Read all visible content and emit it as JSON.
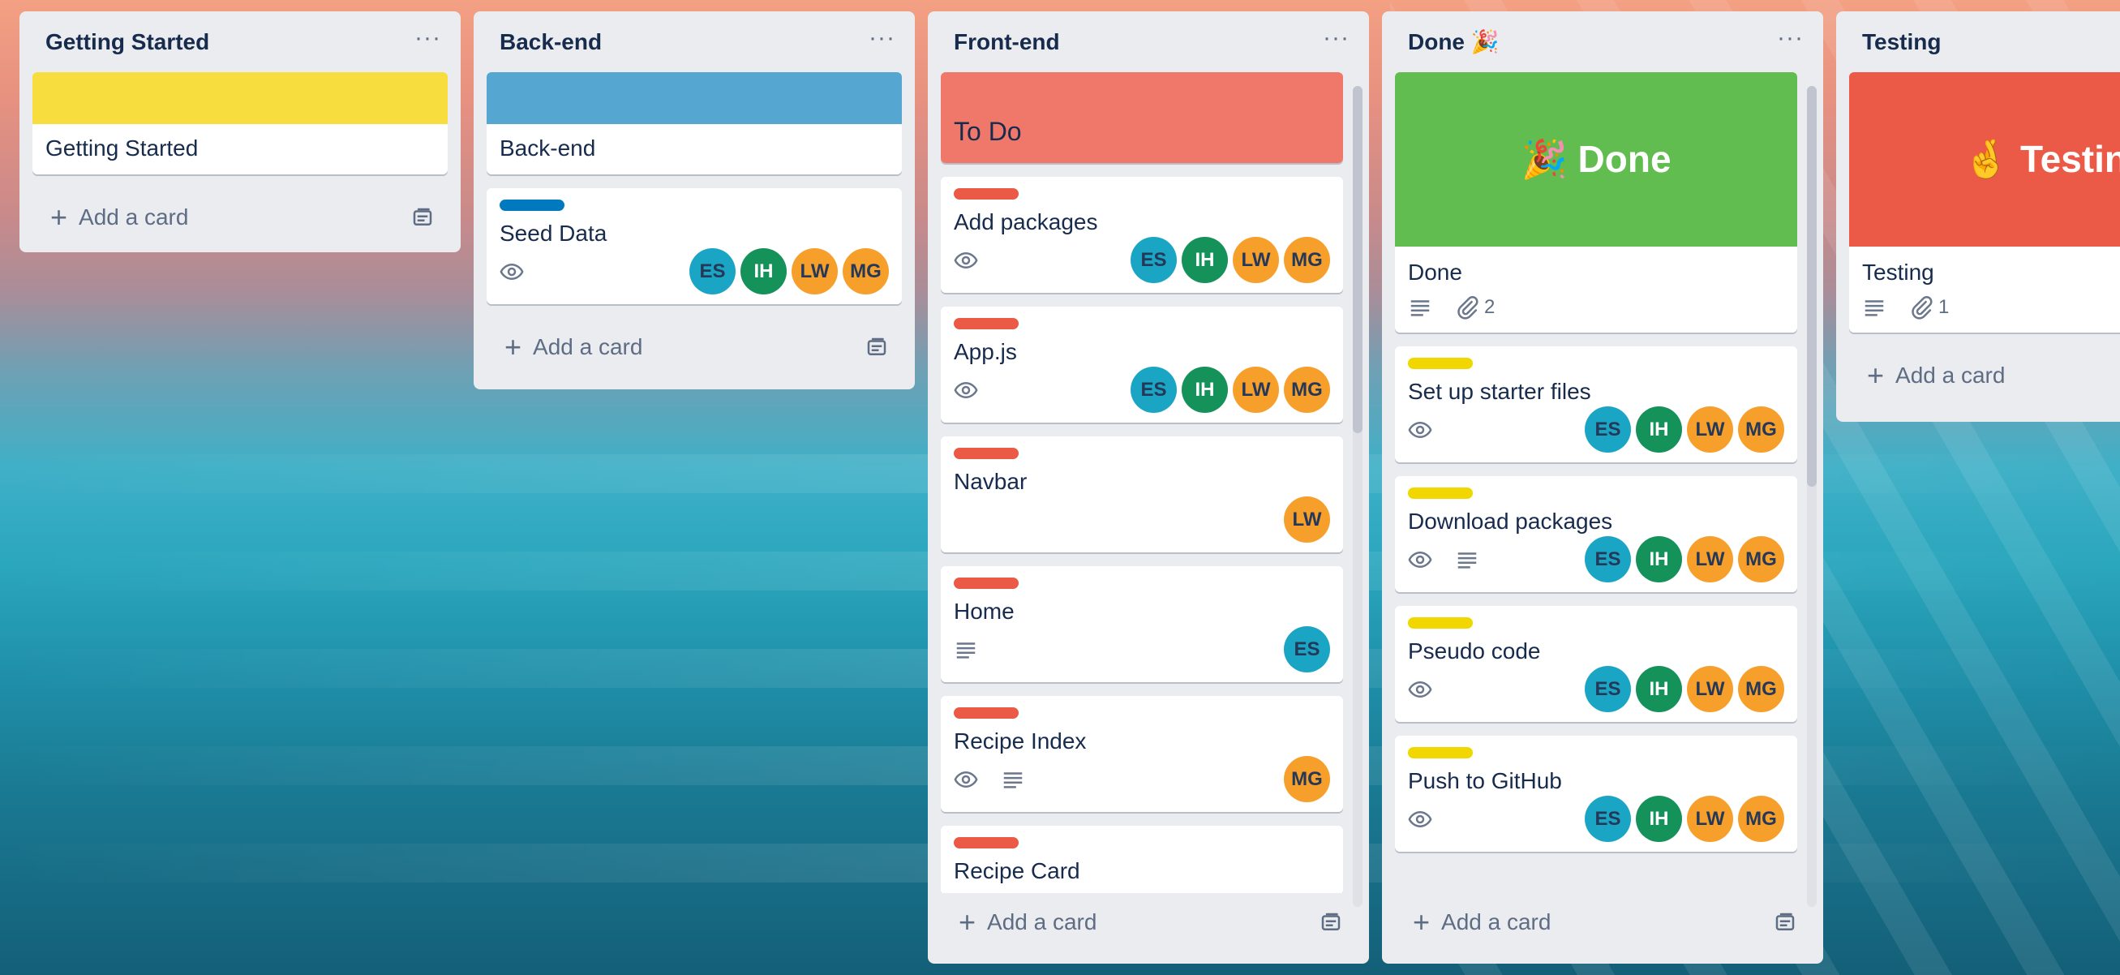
{
  "lists": [
    {
      "title": "Getting Started",
      "cards": [
        {
          "cover_color": "#f8dd3f",
          "title": "Getting Started"
        }
      ],
      "add_card": "Add a card"
    },
    {
      "title": "Back-end",
      "cards": [
        {
          "cover_color": "#55a6d1",
          "title": "Back-end"
        },
        {
          "label_color": "#0079bf",
          "title": "Seed Data",
          "watch": true,
          "members": [
            "ES",
            "IH",
            "LW",
            "MG"
          ]
        }
      ],
      "add_card": "Add a card"
    },
    {
      "title": "Front-end",
      "cards": [
        {
          "cover_color": "#f0786a",
          "title": "To Do"
        },
        {
          "label_color": "#eb5a46",
          "title": "Add packages",
          "watch": true,
          "members": [
            "ES",
            "IH",
            "LW",
            "MG"
          ]
        },
        {
          "label_color": "#eb5a46",
          "title": "App.js",
          "watch": true,
          "members": [
            "ES",
            "IH",
            "LW",
            "MG"
          ]
        },
        {
          "label_color": "#eb5a46",
          "title": "Navbar",
          "members": [
            "LW"
          ]
        },
        {
          "label_color": "#eb5a46",
          "title": "Home",
          "description": true,
          "members": [
            "ES"
          ]
        },
        {
          "label_color": "#eb5a46",
          "title": "Recipe Index",
          "watch": true,
          "description": true,
          "members": [
            "MG"
          ]
        },
        {
          "label_color": "#eb5a46",
          "title": "Recipe Card"
        }
      ],
      "add_card": "Add a card"
    },
    {
      "title": "Done 🎉",
      "cards": [
        {
          "cover_color": "#61bd4f",
          "cover_text": "🎉 Done",
          "title": "Done",
          "description": true,
          "attachments": "2"
        },
        {
          "label_color": "#f2d600",
          "title": "Set up starter files",
          "watch": true,
          "members": [
            "ES",
            "IH",
            "LW",
            "MG"
          ]
        },
        {
          "label_color": "#f2d600",
          "title": "Download packages",
          "watch": true,
          "description": true,
          "members": [
            "ES",
            "IH",
            "LW",
            "MG"
          ]
        },
        {
          "label_color": "#f2d600",
          "title": "Pseudo code",
          "watch": true,
          "members": [
            "ES",
            "IH",
            "LW",
            "MG"
          ]
        },
        {
          "label_color": "#f2d600",
          "title": "Push to GitHub",
          "watch": true,
          "members": [
            "ES",
            "IH",
            "LW",
            "MG"
          ]
        }
      ],
      "add_card": "Add a card"
    },
    {
      "title": "Testing",
      "cards": [
        {
          "cover_color": "#eb5a46",
          "cover_text": "🤞 Testing",
          "title": "Testing",
          "description": true,
          "attachments": "1"
        }
      ],
      "add_card": "Add a card"
    }
  ],
  "icons": {
    "more": "more-horizontal-icon",
    "plus": "plus-icon",
    "template": "card-template-icon",
    "watch": "eye-icon",
    "description": "description-lines-icon",
    "attachment": "paperclip-icon"
  }
}
